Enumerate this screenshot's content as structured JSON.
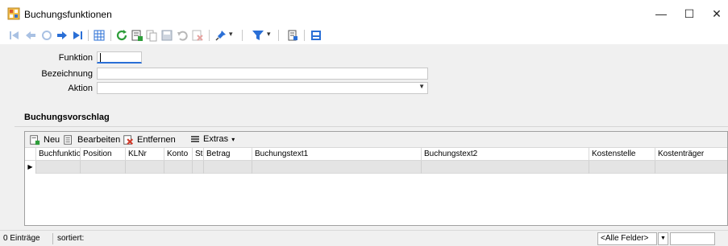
{
  "window": {
    "title": "Buchungsfunktionen",
    "minimize_glyph": "—",
    "maximize_glyph": "☐",
    "close_glyph": "✕"
  },
  "toolbar": {
    "icons": [
      "first-record-icon",
      "previous-record-icon",
      "refresh-disabled-icon",
      "next-record-icon",
      "last-record-icon",
      "table-view-icon",
      "reload-icon",
      "new-record-icon",
      "copy-icon",
      "save-icon",
      "undo-icon",
      "delete-icon",
      "pin-icon",
      "filter-icon",
      "document-icon",
      "info-icon"
    ],
    "dropdown_glyph": "▾"
  },
  "form": {
    "funktion_label": "Funktion",
    "funktion_value": "",
    "bezeichnung_label": "Bezeichnung",
    "bezeichnung_value": "",
    "aktion_label": "Aktion",
    "aktion_value": "",
    "aktion_arrow": "▼"
  },
  "buchungsvorschlag": {
    "header": "Buchungsvorschlag",
    "toolbar": {
      "new_label": "Neu",
      "edit_label": "Bearbeiten",
      "remove_label": "Entfernen",
      "extras_label": "Extras",
      "extras_arrow": "▾"
    },
    "columns": [
      "Buchfunktio",
      "Position",
      "KLNr",
      "Konto",
      "Ste",
      "Betrag",
      "Buchungstext1",
      "Buchungstext2",
      "Kostenstelle",
      "Kostenträger"
    ],
    "row_marker": "▶"
  },
  "statusbar": {
    "count": "0 Einträge",
    "sorted": "sortiert:",
    "filter_value": "<Alle Felder>",
    "filter_arrow": "▼"
  },
  "colors": {
    "accent_blue": "#2a6fd6",
    "green": "#2e9e3a",
    "red": "#d23a2a"
  }
}
